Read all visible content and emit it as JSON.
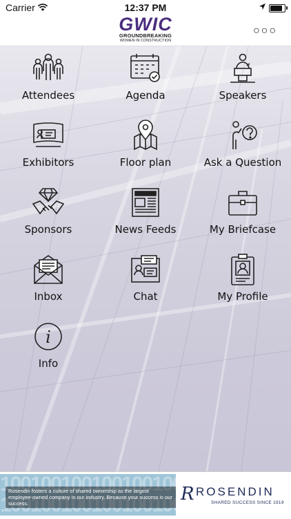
{
  "status_bar": {
    "carrier": "Carrier",
    "time": "12:37 PM"
  },
  "header": {
    "logo_main": "GWIC",
    "logo_line1": "GROUNDBREAKING",
    "logo_line2": "WOMEN IN CONSTRUCTION",
    "menu_icon": "ellipsis-icon"
  },
  "tiles": [
    {
      "label": "Attendees",
      "icon": "attendees-icon"
    },
    {
      "label": "Agenda",
      "icon": "calendar-icon"
    },
    {
      "label": "Speakers",
      "icon": "speaker-podium-icon"
    },
    {
      "label": "Exhibitors",
      "icon": "exhibitor-booth-icon"
    },
    {
      "label": "Floor plan",
      "icon": "map-pin-icon"
    },
    {
      "label": "Ask a Question",
      "icon": "question-person-icon"
    },
    {
      "label": "Sponsors",
      "icon": "handshake-diamond-icon"
    },
    {
      "label": "News Feeds",
      "icon": "newspaper-icon"
    },
    {
      "label": "My Briefcase",
      "icon": "briefcase-icon"
    },
    {
      "label": "Inbox",
      "icon": "envelope-icon"
    },
    {
      "label": "Chat",
      "icon": "chat-icon"
    },
    {
      "label": "My Profile",
      "icon": "profile-badge-icon"
    },
    {
      "label": "Info",
      "icon": "info-icon"
    }
  ],
  "footer": {
    "ad_text": "Rosendin fosters a culture of shared ownership as the largest employee-owned company in our industry. Because your success is our success.",
    "brand": "ROSENDIN",
    "tagline": "SHARED SUCCESS SINCE 1919"
  },
  "colors": {
    "brand_purple": "#4b2d7f",
    "rosendin_navy": "#1d2b57",
    "footer_ad_bg": "#9ec4d8"
  }
}
